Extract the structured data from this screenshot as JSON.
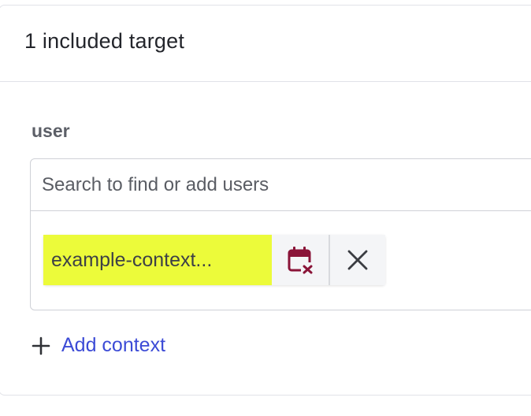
{
  "header": {
    "title": "1 included target"
  },
  "field": {
    "label": "user",
    "search_placeholder": "Search to find or add users"
  },
  "chip": {
    "text": "example-context...",
    "schedule_icon": "calendar-x-icon",
    "remove_icon": "close-icon",
    "highlight_color": "#ecfb3a",
    "calendar_icon_color": "#8a1438"
  },
  "actions": {
    "add_context_label": "Add context",
    "add_icon": "plus-icon",
    "link_color": "#3c4bd6"
  }
}
